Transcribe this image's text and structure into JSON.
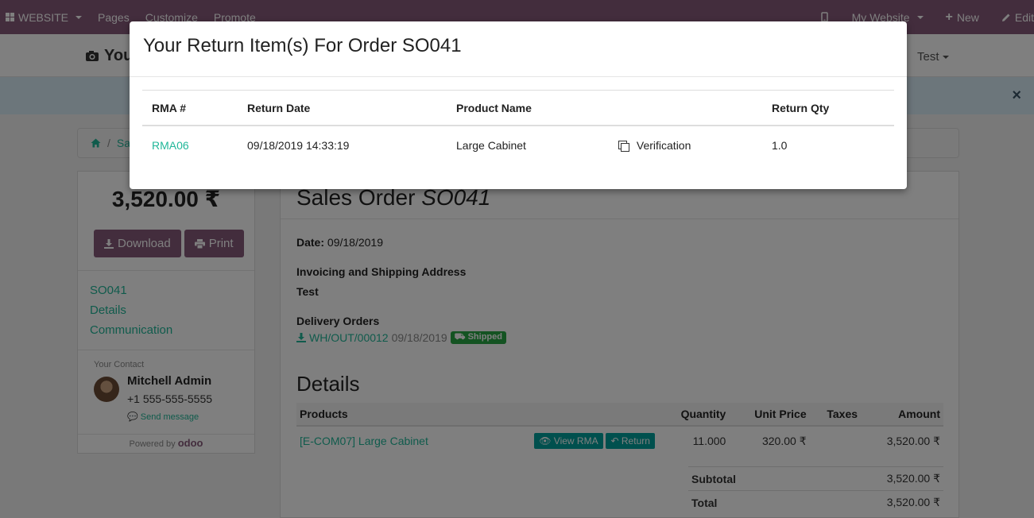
{
  "topbar": {
    "website": "WEBSITE",
    "pages": "Pages",
    "customize": "Customize",
    "promote": "Promote",
    "my_website": "My Website",
    "new": "New",
    "edit": "Edit"
  },
  "header": {
    "logo_text": "You",
    "user": "Test"
  },
  "breadcrumb": {
    "current": "Sa"
  },
  "sidebar": {
    "amount": "3,520.00 ₹",
    "download": "Download",
    "print": "Print",
    "nav": [
      "SO041",
      "Details",
      "Communication"
    ],
    "contact_title": "Your Contact",
    "contact_name": "Mitchell Admin",
    "contact_phone": "+1 555-555-5555",
    "send_message": "Send message",
    "powered_by": "Powered by",
    "brand": "odoo"
  },
  "main": {
    "title_prefix": "Sales Order",
    "title_ref": "SO041",
    "date_label": "Date:",
    "date_value": "09/18/2019",
    "address_label": "Invoicing and Shipping Address",
    "address_value": "Test",
    "delivery_label": "Delivery Orders",
    "delivery_ref": "WH/OUT/00012",
    "delivery_date": "09/18/2019",
    "delivery_status": "Shipped",
    "details_heading": "Details",
    "columns": {
      "products": "Products",
      "quantity": "Quantity",
      "unit_price": "Unit Price",
      "taxes": "Taxes",
      "amount": "Amount"
    },
    "rows": [
      {
        "product": "[E-COM07] Large Cabinet",
        "view_rma": "View RMA",
        "return": "Return",
        "quantity": "11.000",
        "unit_price": "320.00 ₹",
        "taxes": "",
        "amount": "3,520.00 ₹"
      }
    ],
    "subtotal_label": "Subtotal",
    "subtotal_value": "3,520.00 ₹",
    "total_label": "Total",
    "total_value": "3,520.00 ₹"
  },
  "modal": {
    "title": "Your Return Item(s) For Order SO041",
    "columns": {
      "rma": "RMA #",
      "return_date": "Return Date",
      "product_name": "Product Name",
      "return_qty": "Return Qty"
    },
    "rows": [
      {
        "rma": "RMA06",
        "return_date": "09/18/2019 14:33:19",
        "product_name": "Large Cabinet",
        "status": "Verification",
        "return_qty": "1.0"
      }
    ]
  },
  "colors": {
    "brand": "#875a7b",
    "link": "#21b799",
    "teal_button": "#00a09d",
    "shipped_badge": "#28a745"
  },
  "icons": {
    "website": "grid-icon",
    "mobile": "mobile-icon",
    "new": "plus-icon",
    "edit": "pencil-icon",
    "home": "home-icon",
    "download": "download-icon",
    "print": "print-icon",
    "message": "comment-icon",
    "truck": "truck-icon",
    "eye": "eye-icon",
    "reply": "reply-icon",
    "copy": "copy-icon",
    "close": "close-icon",
    "camera": "camera-icon"
  }
}
